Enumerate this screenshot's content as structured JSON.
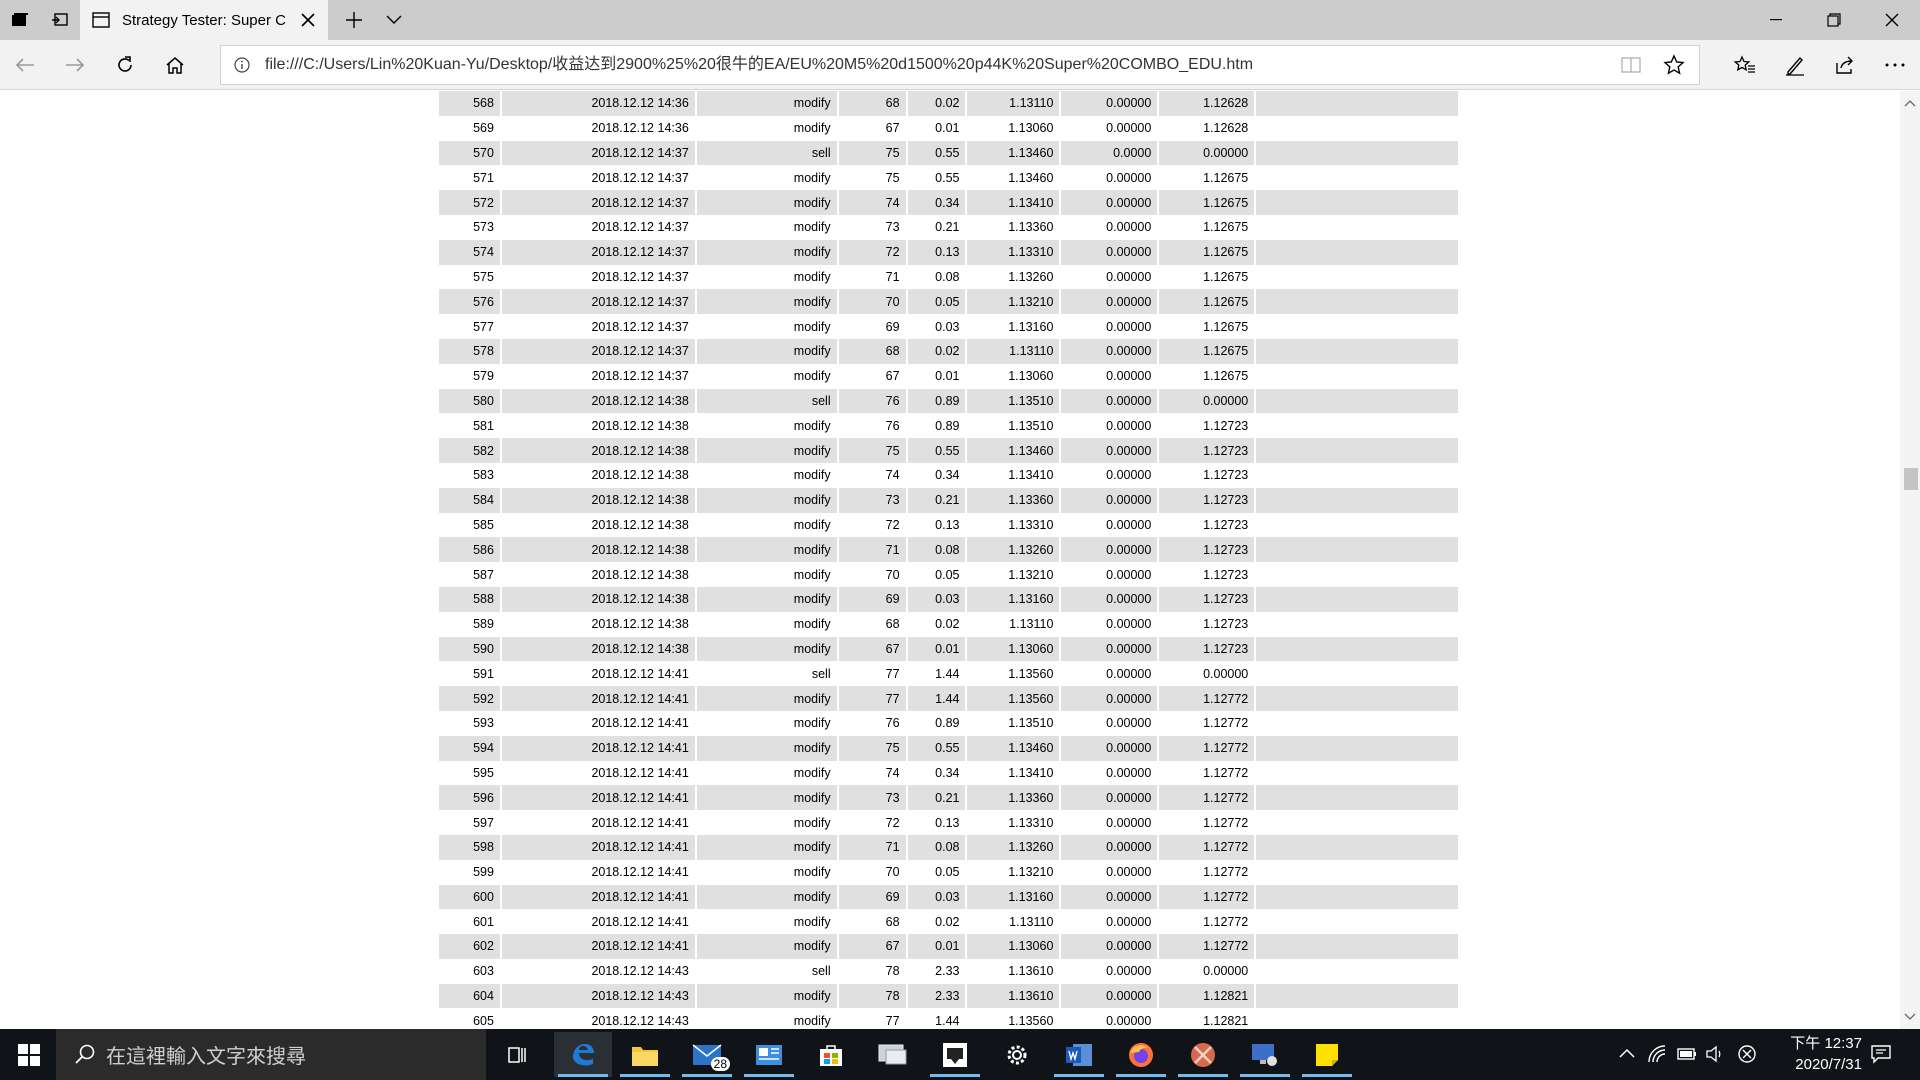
{
  "browser": {
    "tab_title": "Strategy Tester: Super C",
    "address": "file:///C:/Users/Lin%20Kuan-Yu/Desktop/收益达到2900%25%20很牛的EA/EU%20M5%20d1500%20p44K%20Super%20COMBO_EDU.htm"
  },
  "trades": [
    [
      "568",
      "2018.12.12 14:36",
      "modify",
      "68",
      "0.02",
      "1.13110",
      "0.00000",
      "1.12628"
    ],
    [
      "569",
      "2018.12.12 14:36",
      "modify",
      "67",
      "0.01",
      "1.13060",
      "0.00000",
      "1.12628"
    ],
    [
      "570",
      "2018.12.12 14:37",
      "sell",
      "75",
      "0.55",
      "1.13460",
      "0.0000",
      "0.00000"
    ],
    [
      "571",
      "2018.12.12 14:37",
      "modify",
      "75",
      "0.55",
      "1.13460",
      "0.00000",
      "1.12675"
    ],
    [
      "572",
      "2018.12.12 14:37",
      "modify",
      "74",
      "0.34",
      "1.13410",
      "0.00000",
      "1.12675"
    ],
    [
      "573",
      "2018.12.12 14:37",
      "modify",
      "73",
      "0.21",
      "1.13360",
      "0.00000",
      "1.12675"
    ],
    [
      "574",
      "2018.12.12 14:37",
      "modify",
      "72",
      "0.13",
      "1.13310",
      "0.00000",
      "1.12675"
    ],
    [
      "575",
      "2018.12.12 14:37",
      "modify",
      "71",
      "0.08",
      "1.13260",
      "0.00000",
      "1.12675"
    ],
    [
      "576",
      "2018.12.12 14:37",
      "modify",
      "70",
      "0.05",
      "1.13210",
      "0.00000",
      "1.12675"
    ],
    [
      "577",
      "2018.12.12 14:37",
      "modify",
      "69",
      "0.03",
      "1.13160",
      "0.00000",
      "1.12675"
    ],
    [
      "578",
      "2018.12.12 14:37",
      "modify",
      "68",
      "0.02",
      "1.13110",
      "0.00000",
      "1.12675"
    ],
    [
      "579",
      "2018.12.12 14:37",
      "modify",
      "67",
      "0.01",
      "1.13060",
      "0.00000",
      "1.12675"
    ],
    [
      "580",
      "2018.12.12 14:38",
      "sell",
      "76",
      "0.89",
      "1.13510",
      "0.00000",
      "0.00000"
    ],
    [
      "581",
      "2018.12.12 14:38",
      "modify",
      "76",
      "0.89",
      "1.13510",
      "0.00000",
      "1.12723"
    ],
    [
      "582",
      "2018.12.12 14:38",
      "modify",
      "75",
      "0.55",
      "1.13460",
      "0.00000",
      "1.12723"
    ],
    [
      "583",
      "2018.12.12 14:38",
      "modify",
      "74",
      "0.34",
      "1.13410",
      "0.00000",
      "1.12723"
    ],
    [
      "584",
      "2018.12.12 14:38",
      "modify",
      "73",
      "0.21",
      "1.13360",
      "0.00000",
      "1.12723"
    ],
    [
      "585",
      "2018.12.12 14:38",
      "modify",
      "72",
      "0.13",
      "1.13310",
      "0.00000",
      "1.12723"
    ],
    [
      "586",
      "2018.12.12 14:38",
      "modify",
      "71",
      "0.08",
      "1.13260",
      "0.00000",
      "1.12723"
    ],
    [
      "587",
      "2018.12.12 14:38",
      "modify",
      "70",
      "0.05",
      "1.13210",
      "0.00000",
      "1.12723"
    ],
    [
      "588",
      "2018.12.12 14:38",
      "modify",
      "69",
      "0.03",
      "1.13160",
      "0.00000",
      "1.12723"
    ],
    [
      "589",
      "2018.12.12 14:38",
      "modify",
      "68",
      "0.02",
      "1.13110",
      "0.00000",
      "1.12723"
    ],
    [
      "590",
      "2018.12.12 14:38",
      "modify",
      "67",
      "0.01",
      "1.13060",
      "0.00000",
      "1.12723"
    ],
    [
      "591",
      "2018.12.12 14:41",
      "sell",
      "77",
      "1.44",
      "1.13560",
      "0.00000",
      "0.00000"
    ],
    [
      "592",
      "2018.12.12 14:41",
      "modify",
      "77",
      "1.44",
      "1.13560",
      "0.00000",
      "1.12772"
    ],
    [
      "593",
      "2018.12.12 14:41",
      "modify",
      "76",
      "0.89",
      "1.13510",
      "0.00000",
      "1.12772"
    ],
    [
      "594",
      "2018.12.12 14:41",
      "modify",
      "75",
      "0.55",
      "1.13460",
      "0.00000",
      "1.12772"
    ],
    [
      "595",
      "2018.12.12 14:41",
      "modify",
      "74",
      "0.34",
      "1.13410",
      "0.00000",
      "1.12772"
    ],
    [
      "596",
      "2018.12.12 14:41",
      "modify",
      "73",
      "0.21",
      "1.13360",
      "0.00000",
      "1.12772"
    ],
    [
      "597",
      "2018.12.12 14:41",
      "modify",
      "72",
      "0.13",
      "1.13310",
      "0.00000",
      "1.12772"
    ],
    [
      "598",
      "2018.12.12 14:41",
      "modify",
      "71",
      "0.08",
      "1.13260",
      "0.00000",
      "1.12772"
    ],
    [
      "599",
      "2018.12.12 14:41",
      "modify",
      "70",
      "0.05",
      "1.13210",
      "0.00000",
      "1.12772"
    ],
    [
      "600",
      "2018.12.12 14:41",
      "modify",
      "69",
      "0.03",
      "1.13160",
      "0.00000",
      "1.12772"
    ],
    [
      "601",
      "2018.12.12 14:41",
      "modify",
      "68",
      "0.02",
      "1.13110",
      "0.00000",
      "1.12772"
    ],
    [
      "602",
      "2018.12.12 14:41",
      "modify",
      "67",
      "0.01",
      "1.13060",
      "0.00000",
      "1.12772"
    ],
    [
      "603",
      "2018.12.12 14:43",
      "sell",
      "78",
      "2.33",
      "1.13610",
      "0.00000",
      "0.00000"
    ],
    [
      "604",
      "2018.12.12 14:43",
      "modify",
      "78",
      "2.33",
      "1.13610",
      "0.00000",
      "1.12821"
    ],
    [
      "605",
      "2018.12.12 14:43",
      "modify",
      "77",
      "1.44",
      "1.13560",
      "0.00000",
      "1.12821"
    ]
  ],
  "taskbar": {
    "search_placeholder": "在這裡輸入文字來搜尋",
    "mail_badge": "28",
    "clock_time": "下午 12:37",
    "clock_date": "2020/7/31"
  },
  "colors": {
    "row_shaded": "#e0e0e0",
    "taskbar_bg": "#101418",
    "edge_blue": "#1e7ad6"
  }
}
